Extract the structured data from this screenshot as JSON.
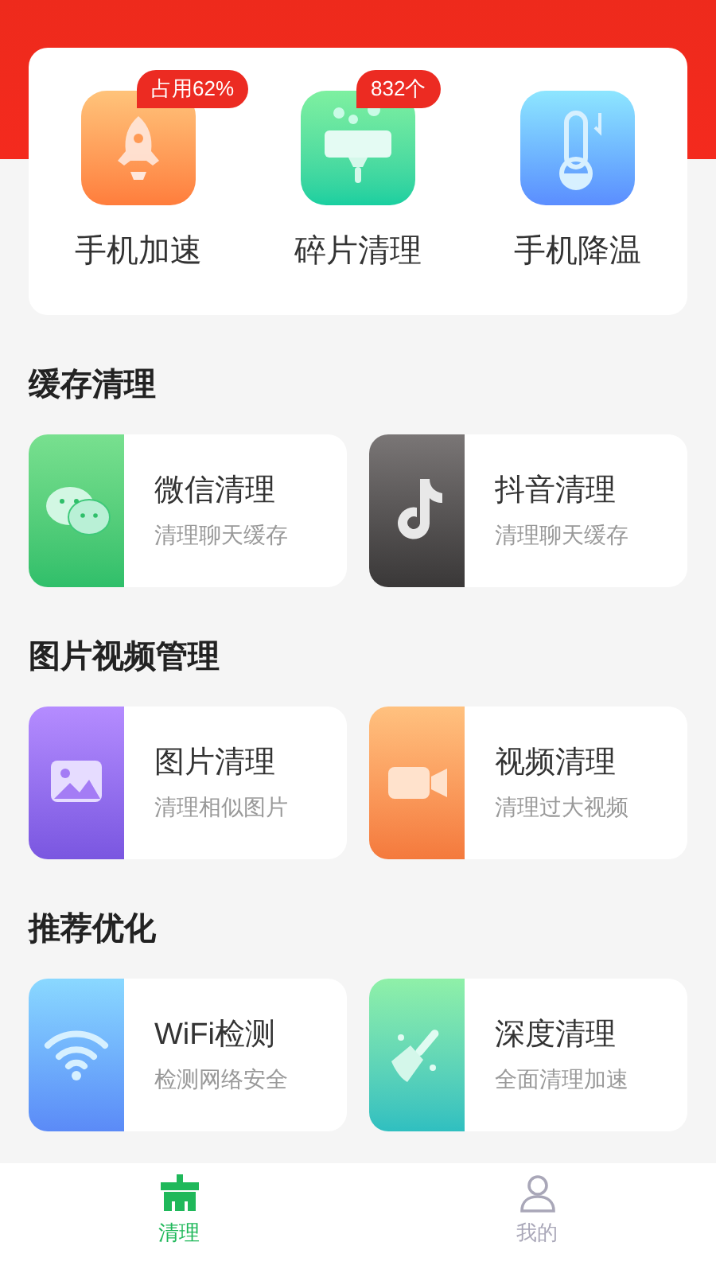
{
  "tools": [
    {
      "kind": "rocket",
      "label": "手机加速",
      "badge": "占用62%"
    },
    {
      "kind": "sink",
      "label": "碎片清理",
      "badge": "832个"
    },
    {
      "kind": "thermometer",
      "label": "手机降温"
    }
  ],
  "sections": [
    {
      "title": "缓存清理",
      "cards": [
        {
          "kind": "chat",
          "title": "微信清理",
          "subtitle": "清理聊天缓存"
        },
        {
          "kind": "note",
          "title": "抖音清理",
          "subtitle": "清理聊天缓存"
        }
      ]
    },
    {
      "title": "图片视频管理",
      "cards": [
        {
          "kind": "image",
          "title": "图片清理",
          "subtitle": "清理相似图片"
        },
        {
          "kind": "video",
          "title": "视频清理",
          "subtitle": "清理过大视频"
        }
      ]
    },
    {
      "title": "推荐优化",
      "cards": [
        {
          "kind": "wifi",
          "title": "WiFi检测",
          "subtitle": "检测网络安全"
        },
        {
          "kind": "broom",
          "title": "深度清理",
          "subtitle": "全面清理加速"
        }
      ]
    }
  ],
  "tab_bar": [
    {
      "kind": "clean",
      "label": "清理",
      "selected": true
    },
    {
      "kind": "profile",
      "label": "我的",
      "selected": false
    }
  ]
}
